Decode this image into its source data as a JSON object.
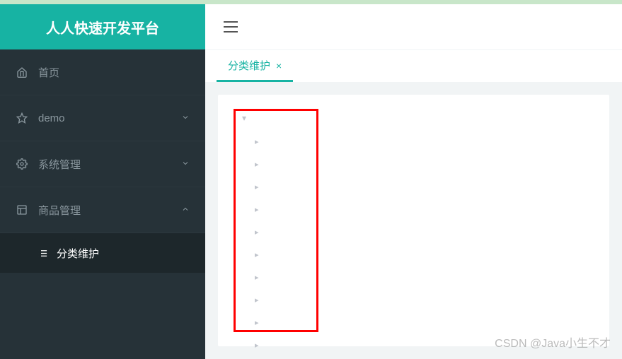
{
  "brand": {
    "title": "人人快速开发平台"
  },
  "sidebar": {
    "items": [
      {
        "icon": "home-icon",
        "label": "首页",
        "expandable": false
      },
      {
        "icon": "star-icon",
        "label": "demo",
        "expandable": true,
        "expanded": false
      },
      {
        "icon": "gear-icon",
        "label": "系统管理",
        "expandable": true,
        "expanded": false
      },
      {
        "icon": "grid-icon",
        "label": "商品管理",
        "expandable": true,
        "expanded": true,
        "children": [
          {
            "icon": "list-icon",
            "label": "分类维护"
          }
        ]
      }
    ]
  },
  "tabs": {
    "active": {
      "label": "分类维护"
    }
  },
  "tree": {
    "root_expanded": true,
    "child_count": 10
  },
  "watermark": "CSDN @Java小生不才"
}
